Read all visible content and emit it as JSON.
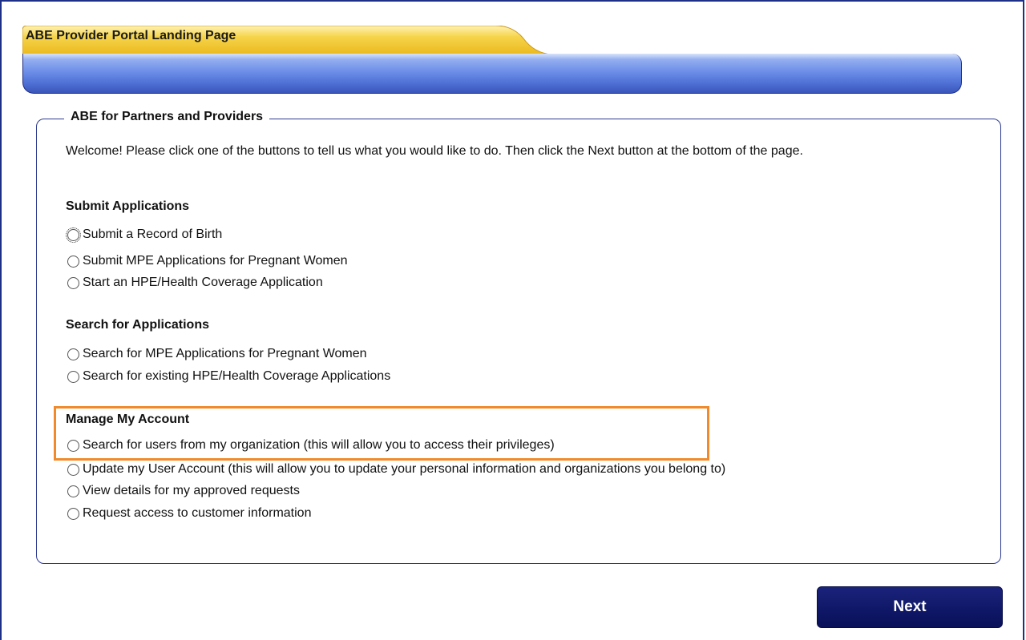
{
  "header": {
    "tab_title": "ABE Provider Portal Landing Page"
  },
  "section": {
    "legend": "ABE for Partners and Providers",
    "welcome": "Welcome! Please click one of the buttons to tell us what you would like to do. Then click the Next button at the bottom of the page."
  },
  "groups": [
    {
      "heading": "Submit Applications",
      "options": [
        "Submit a Record of Birth",
        "Submit MPE Applications for Pregnant Women",
        "Start an HPE/Health Coverage Application"
      ]
    },
    {
      "heading": "Search for Applications",
      "options": [
        "Search for MPE Applications for Pregnant Women",
        "Search for existing HPE/Health Coverage Applications"
      ]
    },
    {
      "heading": "Manage My Account",
      "options": [
        "Search for users from my organization (this will allow you to access their privileges)",
        "Update my User Account (this will allow you to update your personal information and organizations you belong to)",
        "View details for my approved requests",
        "Request access to customer information"
      ]
    }
  ],
  "footer": {
    "next_label": "Next"
  },
  "colors": {
    "tab_gold": "#f3c531",
    "bar_blue": "#4f70d6",
    "border_navy": "#2b3990",
    "highlight_orange": "#f08a2c",
    "button_navy": "#0e1766"
  }
}
